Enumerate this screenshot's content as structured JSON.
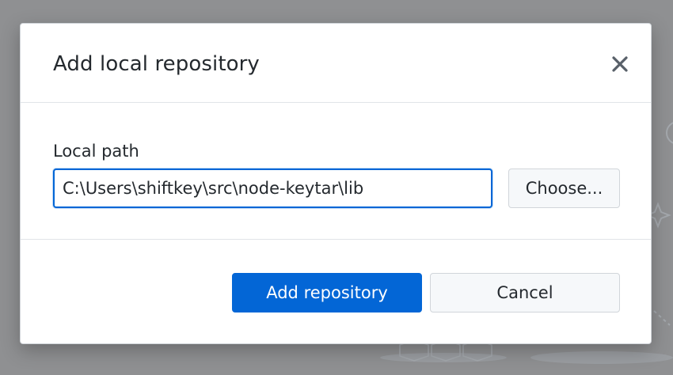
{
  "dialog": {
    "title": "Add local repository",
    "close_icon": "close-icon"
  },
  "local_path": {
    "label": "Local path",
    "value": "C:\\Users\\shiftkey\\src\\node-keytar\\lib",
    "choose_label": "Choose..."
  },
  "footer": {
    "primary_label": "Add repository",
    "cancel_label": "Cancel"
  },
  "colors": {
    "accent": "#0366d6",
    "overlay": "#8f9092",
    "text": "#24292e",
    "border": "#d1d5da"
  }
}
